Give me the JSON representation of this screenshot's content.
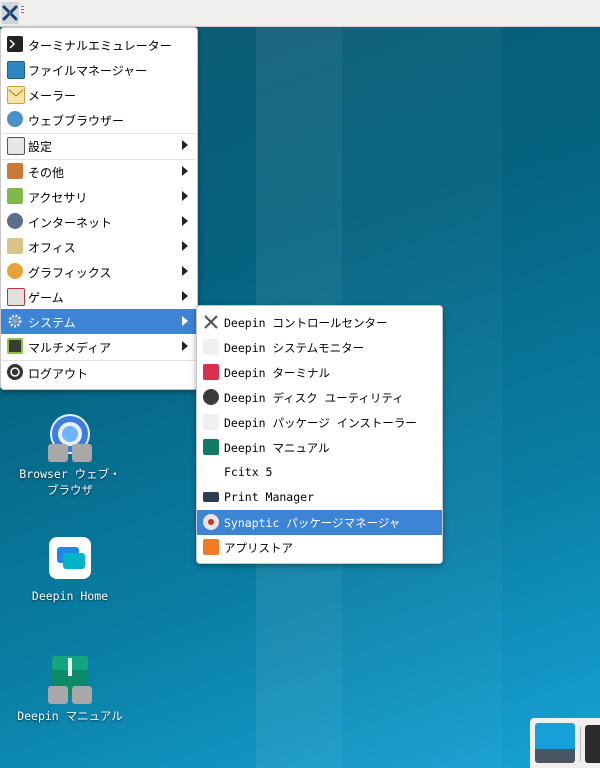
{
  "main_menu": {
    "items": [
      {
        "label": "ターミナルエミュレーター",
        "icon": "terminal-icon",
        "submenu": false
      },
      {
        "label": "ファイルマネージャー",
        "icon": "file-manager-icon",
        "submenu": false
      },
      {
        "label": "メーラー",
        "icon": "mail-icon",
        "submenu": false
      },
      {
        "label": "ウェブブラウザー",
        "icon": "web-browser-icon",
        "submenu": false
      },
      {
        "label": "設定",
        "icon": "settings-icon",
        "submenu": true
      },
      {
        "label": "その他",
        "icon": "other-icon",
        "submenu": true
      },
      {
        "label": "アクセサリ",
        "icon": "accessories-icon",
        "submenu": true
      },
      {
        "label": "インターネット",
        "icon": "internet-icon",
        "submenu": true
      },
      {
        "label": "オフィス",
        "icon": "office-icon",
        "submenu": true
      },
      {
        "label": "グラフィックス",
        "icon": "graphics-icon",
        "submenu": true
      },
      {
        "label": "ゲーム",
        "icon": "games-icon",
        "submenu": true
      },
      {
        "label": "システム",
        "icon": "system-gear-icon",
        "submenu": true,
        "active": true
      },
      {
        "label": "マルチメディア",
        "icon": "multimedia-icon",
        "submenu": true
      },
      {
        "label": "ログアウト",
        "icon": "logout-icon",
        "submenu": false
      }
    ]
  },
  "system_submenu": {
    "items": [
      {
        "label": "Deepin コントロールセンター",
        "icon": "control-center-icon"
      },
      {
        "label": "Deepin システムモニター",
        "icon": "system-monitor-icon"
      },
      {
        "label": "Deepin ターミナル",
        "icon": "deepin-terminal-icon"
      },
      {
        "label": "Deepin ディスク ユーティリティ",
        "icon": "disk-utility-icon"
      },
      {
        "label": "Deepin パッケージ インストーラー",
        "icon": "package-installer-icon"
      },
      {
        "label": "Deepin マニュアル",
        "icon": "manual-icon"
      },
      {
        "label": "Fcitx 5",
        "icon": ""
      },
      {
        "label": "Print Manager",
        "icon": "printer-icon"
      },
      {
        "label": "Synaptic パッケージマネージャ",
        "icon": "synaptic-icon",
        "active": true
      },
      {
        "label": "アプリストア",
        "icon": "app-store-icon"
      }
    ]
  },
  "desktop_icons": [
    {
      "label": "Browser ウェブ・ブラウザ",
      "icon": "browser-icon"
    },
    {
      "label": "Deepin Home",
      "icon": "deepin-home-icon"
    },
    {
      "label": "Deepin マニュアル",
      "icon": "deepin-manual-icon"
    }
  ],
  "colors": {
    "accent": "#3d84d6",
    "desktop": "#05627f",
    "panel": "#f1f0ee"
  }
}
